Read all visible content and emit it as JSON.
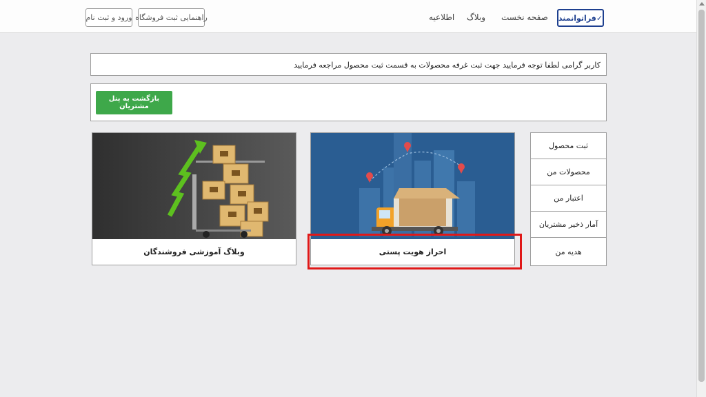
{
  "header": {
    "logo_text": "✓فراتوانمند",
    "nav": {
      "home": "صفحه نخست",
      "blog": "وبلاگ",
      "notice": "اطلاعیه"
    },
    "buttons": {
      "store_guide": "راهنمایی ثبت فروشگاه",
      "login": "ورود و ثبت نام"
    }
  },
  "notice_text": "کاربر گرامی لطفا توجه فرمایید جهت ثبت غرفه محصولات به قسمت ثبت محصول مراجعه فرمایید",
  "back_button": "بازگشت به پنل مشتریان",
  "side_menu": [
    "ثبت محصول",
    "محصولات من",
    "اعتبار من",
    "آمار ذخیر مشتریان",
    "هدیه من"
  ],
  "cards": {
    "postal": {
      "title": "احراز هویت پستی"
    },
    "blog": {
      "title": "وبلاگ آموزشی فروشندگان"
    }
  },
  "colors": {
    "accent_green": "#3ea84a",
    "logo_blue": "#1d3f8f",
    "highlight_red": "#e01818",
    "card_blue_bg": "#2a5d92"
  }
}
